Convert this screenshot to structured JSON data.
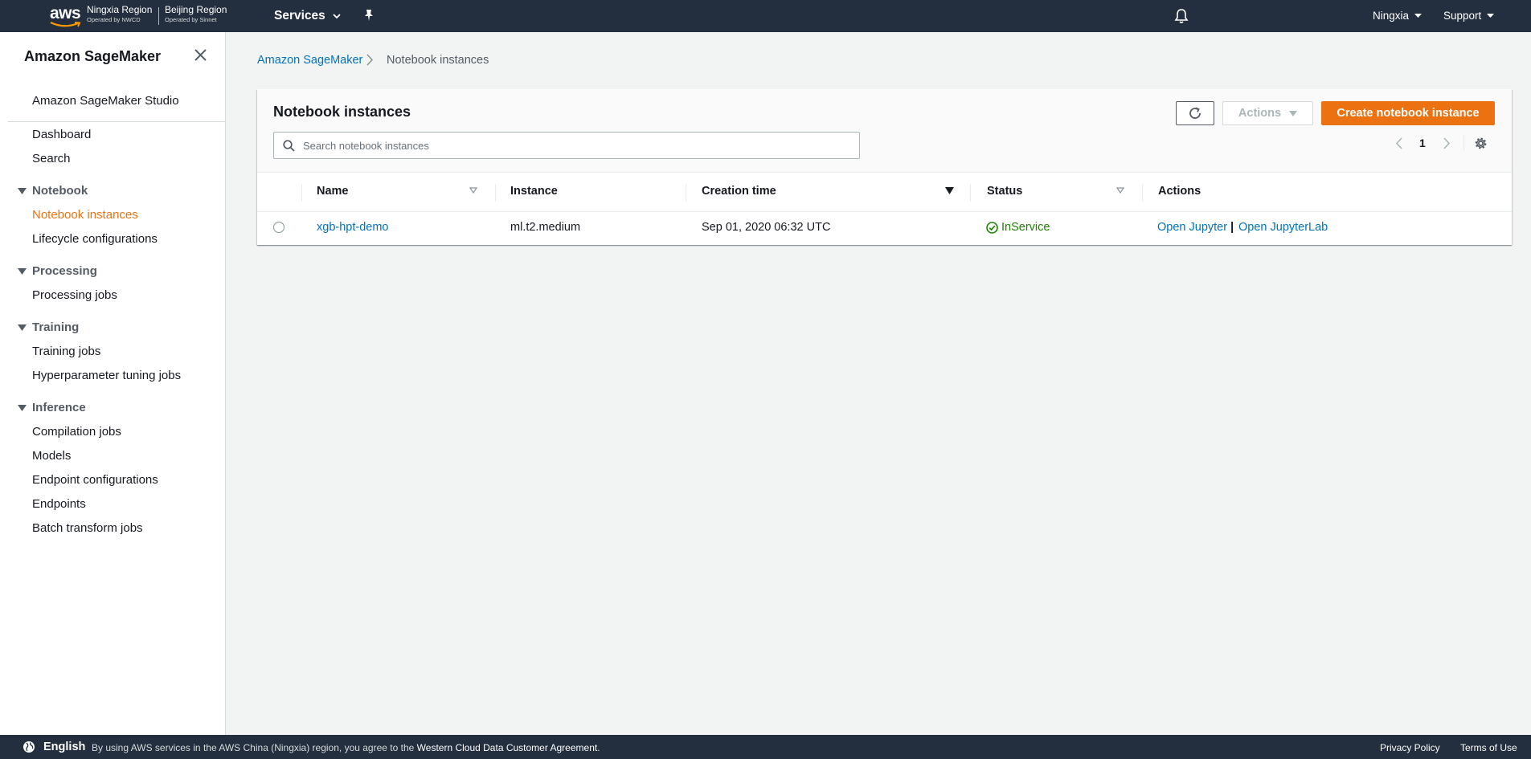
{
  "topnav": {
    "logo_text": "aws",
    "region1": {
      "name": "Ningxia Region",
      "operator": "Operated by NWCD"
    },
    "region2": {
      "name": "Beijing Region",
      "operator": "Operated by Sinnet"
    },
    "services_label": "Services",
    "region_menu_label": "Ningxia",
    "support_label": "Support"
  },
  "sidebar": {
    "title": "Amazon SageMaker",
    "studio": "Amazon SageMaker Studio",
    "dashboard": "Dashboard",
    "search": "Search",
    "sections": [
      {
        "label": "Notebook",
        "items": [
          "Notebook instances",
          "Lifecycle configurations"
        ]
      },
      {
        "label": "Processing",
        "items": [
          "Processing jobs"
        ]
      },
      {
        "label": "Training",
        "items": [
          "Training jobs",
          "Hyperparameter tuning jobs"
        ]
      },
      {
        "label": "Inference",
        "items": [
          "Compilation jobs",
          "Models",
          "Endpoint configurations",
          "Endpoints",
          "Batch transform jobs"
        ]
      }
    ],
    "active_item": "Notebook instances"
  },
  "breadcrumb": {
    "root": "Amazon SageMaker",
    "current": "Notebook instances"
  },
  "panel": {
    "title": "Notebook instances",
    "actions_label": "Actions",
    "create_label": "Create notebook instance",
    "search_placeholder": "Search notebook instances",
    "search_value": "",
    "page_number": "1"
  },
  "table": {
    "columns": [
      "Name",
      "Instance",
      "Creation time",
      "Status",
      "Actions"
    ],
    "rows": [
      {
        "name": "xgb-hpt-demo",
        "instance": "ml.t2.medium",
        "creation_time": "Sep 01, 2020 06:32 UTC",
        "status": "InService",
        "action1": "Open Jupyter",
        "separator": "|",
        "action2": "Open JupyterLab"
      }
    ]
  },
  "footer": {
    "language": "English",
    "notice_prefix": "By using AWS services in the AWS China (Ningxia) region, you agree to the",
    "notice_link": "Western Cloud Data Customer Agreement",
    "notice_suffix": ".",
    "privacy": "Privacy Policy",
    "terms": "Terms of Use"
  },
  "colors": {
    "nav_bg": "#232f3e",
    "accent": "#ec7211",
    "link": "#0073bb",
    "success": "#1d8102"
  }
}
